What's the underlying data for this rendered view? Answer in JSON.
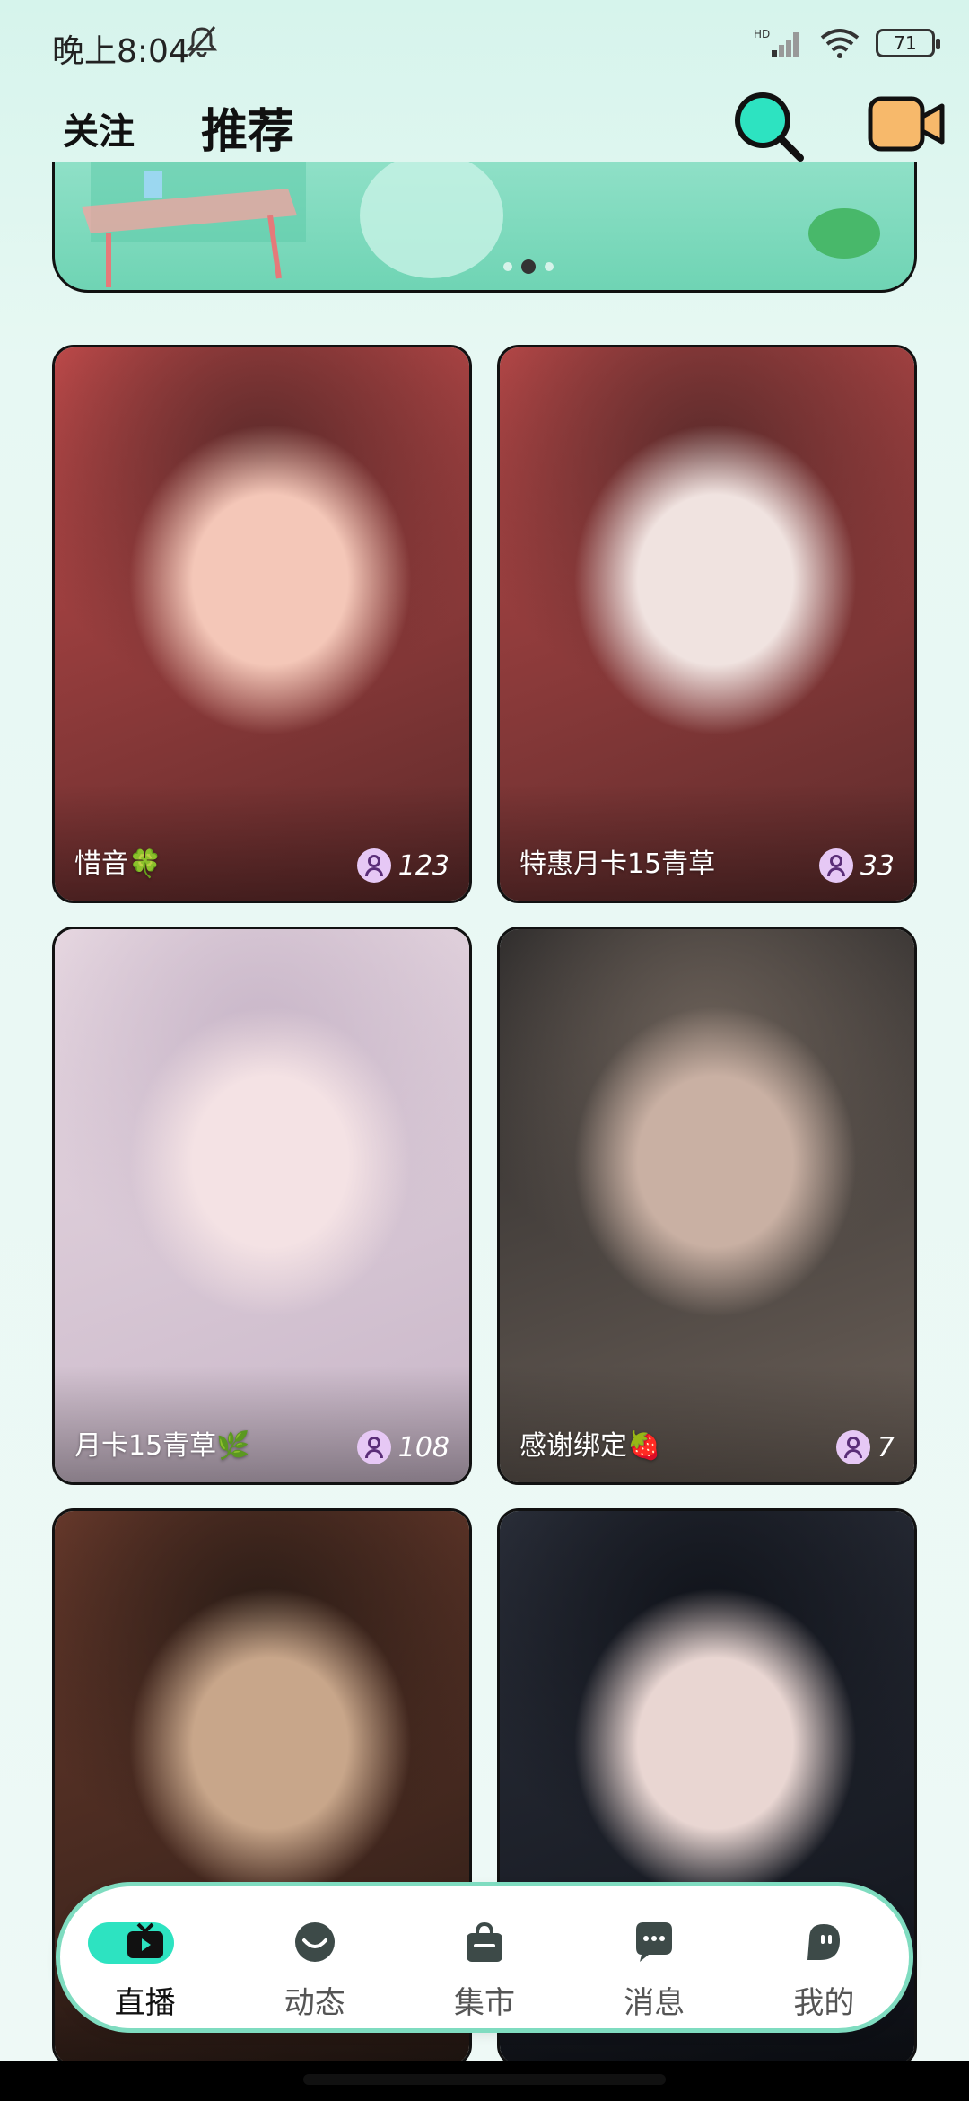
{
  "status_bar": {
    "time": "晚上8:04",
    "network": "HD",
    "battery": "71"
  },
  "top_tabs": {
    "follow": "关注",
    "recommend": "推荐"
  },
  "icons": {
    "search": "search-icon",
    "camera": "video-camera-icon",
    "bell": "bell-off-icon",
    "viewers": "person-icon"
  },
  "colors": {
    "accent": "#2de3c1",
    "camera": "#f7b96b",
    "nav_border": "#7fdcc0",
    "viewer_badge": "#e6c8f5"
  },
  "banner": {
    "pages": 3,
    "active_page": 2
  },
  "streams": [
    {
      "title": "惜音🍀",
      "viewers": "123",
      "tone": [
        "#5c2a2a",
        "#c24b4b",
        "#f4c7b8"
      ]
    },
    {
      "title": "特惠月卡15青草",
      "viewers": "33",
      "tone": [
        "#5b2b2b",
        "#b84848",
        "#f0e3e0"
      ]
    },
    {
      "title": "月卡15青草🌿",
      "viewers": "108",
      "tone": [
        "#c8b6c8",
        "#e8d9e2",
        "#f4e2e4"
      ]
    },
    {
      "title": "感谢绑定🍓",
      "viewers": "7",
      "tone": [
        "#6b6058",
        "#2c2a2a",
        "#c9b0a3"
      ]
    },
    {
      "title": "",
      "viewers": "",
      "tone": [
        "#2a1c16",
        "#6a3a2c",
        "#c8a68a"
      ]
    },
    {
      "title": "",
      "viewers": "",
      "tone": [
        "#10131a",
        "#2b2f3a",
        "#e9d6d2"
      ]
    }
  ],
  "bottom_nav": [
    {
      "label": "直播",
      "icon": "tv-icon",
      "active": true
    },
    {
      "label": "动态",
      "icon": "moments-icon",
      "active": false
    },
    {
      "label": "集市",
      "icon": "shopping-bag-icon",
      "active": false
    },
    {
      "label": "消息",
      "icon": "chat-bubble-icon",
      "active": false
    },
    {
      "label": "我的",
      "icon": "profile-icon",
      "active": false
    }
  ]
}
